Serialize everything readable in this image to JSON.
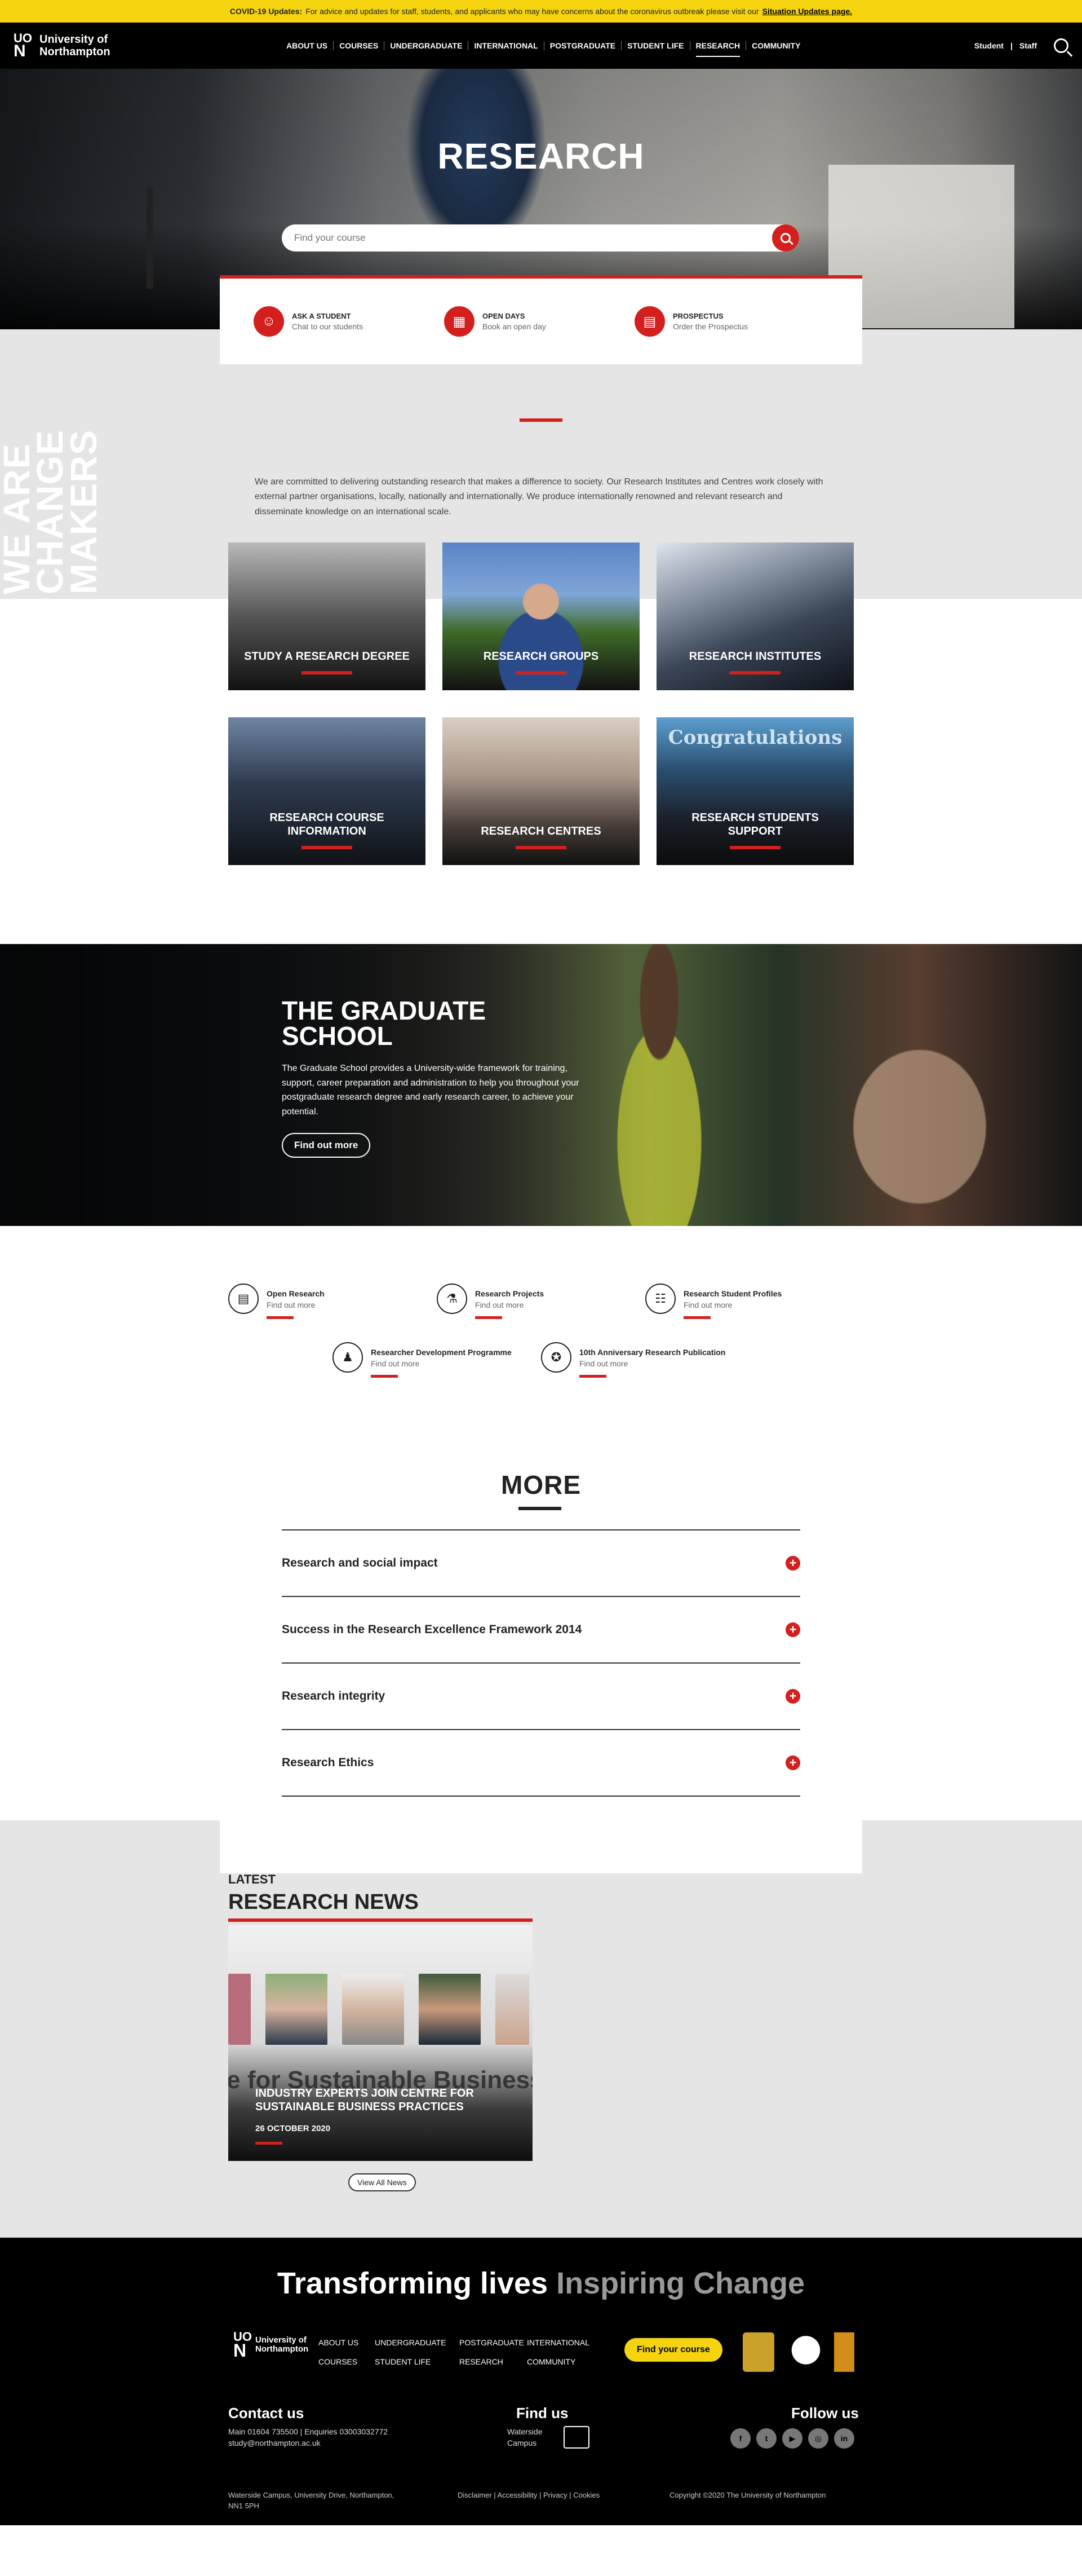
{
  "covid": {
    "label": "COVID-19 Updates:",
    "text": "For advice and updates for staff, students, and applicants who may have concerns about the coronavirus outbreak please visit our",
    "link": "Situation Updates page."
  },
  "header": {
    "logo_mark_top": "UO",
    "logo_mark_bottom": "N",
    "logo_line1": "University of",
    "logo_line2": "Northampton",
    "nav": [
      "ABOUT US",
      "COURSES",
      "UNDERGRADUATE",
      "INTERNATIONAL",
      "POSTGRADUATE",
      "STUDENT LIFE",
      "RESEARCH",
      "COMMUNITY"
    ],
    "student": "Student",
    "staff": "Staff"
  },
  "hero": {
    "title": "RESEARCH",
    "search_placeholder": "Find your course"
  },
  "quick_links": [
    {
      "title": "ASK A STUDENT",
      "sub": "Chat to our students",
      "icon": "chat-icon"
    },
    {
      "title": "OPEN DAYS",
      "sub": "Book an open day",
      "icon": "calendar-icon"
    },
    {
      "title": "PROSPECTUS",
      "sub": "Order the Prospectus",
      "icon": "book-icon"
    }
  ],
  "intro": {
    "vertical_text": [
      "WE ARE",
      "CHANGE",
      "MAKERS"
    ],
    "paragraph": "We are committed to delivering outstanding research that makes a difference to society. Our Research Institutes and Centres work closely with external partner organisations, locally, nationally and internationally. We produce internationally renowned and relevant research and disseminate knowledge on an international scale."
  },
  "tiles": [
    {
      "label": "STUDY A RESEARCH DEGREE"
    },
    {
      "label": "RESEARCH GROUPS"
    },
    {
      "label": "RESEARCH INSTITUTES"
    },
    {
      "label": "RESEARCH COURSE INFORMATION"
    },
    {
      "label": "RESEARCH CENTRES"
    },
    {
      "label": "RESEARCH STUDENTS SUPPORT",
      "banner": "Congratulations"
    }
  ],
  "graduate": {
    "title_line1": "THE GRADUATE",
    "title_line2": "SCHOOL",
    "text": "The Graduate School provides a University-wide framework for training, support, career preparation and administration to help you throughout your postgraduate research degree and early research career, to achieve your potential.",
    "button": "Find out more"
  },
  "links": [
    {
      "title": "Open Research",
      "sub": "Find out more",
      "icon": "open-book-icon"
    },
    {
      "title": "Research Projects",
      "sub": "Find out more",
      "icon": "flask-icon"
    },
    {
      "title": "Research Student Profiles",
      "sub": "Find out more",
      "icon": "id-card-icon"
    },
    {
      "title": "Researcher Development Programme",
      "sub": "Find out more",
      "icon": "people-icon"
    },
    {
      "title": "10th Anniversary Research Publication",
      "sub": "Find out more",
      "icon": "award-icon"
    }
  ],
  "more": {
    "title": "MORE",
    "items": [
      "Research and social impact",
      "Success in the Research Excellence Framework 2014",
      "Research integrity",
      "Research Ethics"
    ]
  },
  "news": {
    "label": "LATEST",
    "title": "RESEARCH NEWS",
    "watermark": "re for Sustainable Business Prac",
    "card_title": "INDUSTRY EXPERTS JOIN CENTRE FOR SUSTAINABLE BUSINESS PRACTICES",
    "date": "26 OCTOBER 2020",
    "view_all": "View All News"
  },
  "footer": {
    "slogan_white": "Transforming lives",
    "slogan_gray": "Inspiring Change",
    "logo_mark": "UO\nN",
    "logo_line1": "University of",
    "logo_line2": "Northampton",
    "links": [
      "ABOUT US",
      "UNDERGRADUATE",
      "POSTGRADUATE",
      "INTERNATIONAL",
      "COURSES",
      "STUDENT LIFE",
      "RESEARCH",
      "COMMUNITY"
    ],
    "cta": "Find your course",
    "contact_title": "Contact us",
    "contact_line1": "Main 01604 735500 | Enquiries 03003032772",
    "contact_line2": "study@northampton.ac.uk",
    "find_title": "Find us",
    "find_line1": "Waterside",
    "find_line2": "Campus",
    "follow_title": "Follow us",
    "social": [
      "f",
      "t",
      "▶",
      "◎",
      "in"
    ],
    "address": "Waterside Campus, University Drive, Northampton,",
    "postcode": "NN1 5PH",
    "legal": "Disclaimer | Accessibility | Privacy | Cookies",
    "copyright": "Copyright ©2020 The University of Northampton"
  }
}
